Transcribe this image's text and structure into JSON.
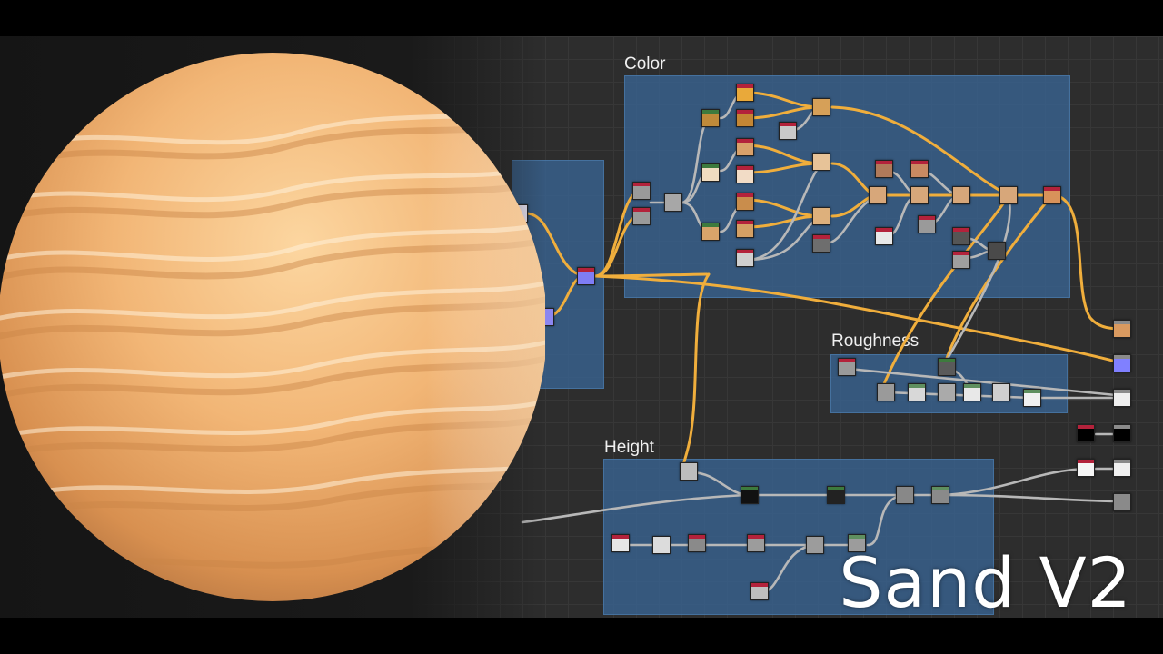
{
  "title": "Sand V2",
  "frames": {
    "color": "Color",
    "roughness": "Roughness",
    "height": "Height"
  },
  "colors": {
    "accent_wire": "#f2b33d",
    "gray_wire": "#b9b9b9",
    "frame_fill": "#3a6594",
    "sand_light": "#f7c98a",
    "sand_dark": "#c9854a",
    "node_purple": "#8080ff",
    "node_orange": "#e0a55a"
  }
}
